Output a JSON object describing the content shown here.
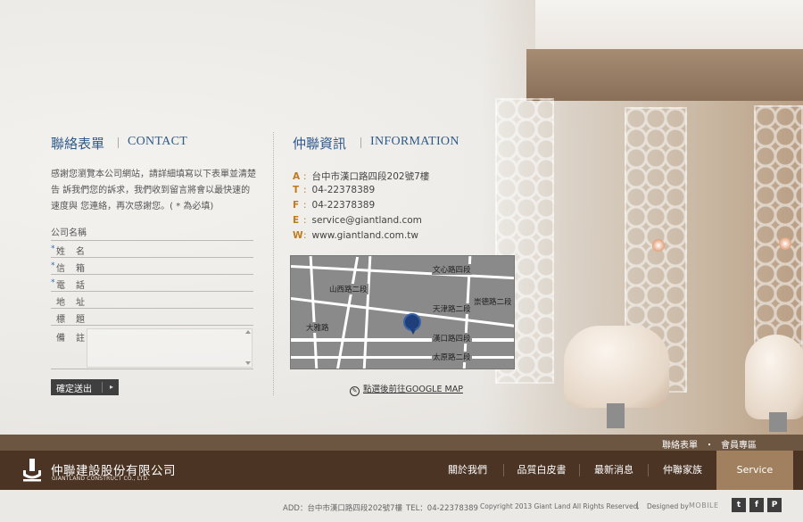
{
  "contact": {
    "title_cn": "聯絡表單",
    "title_en": "CONTACT",
    "intro": "感謝您瀏覽本公司網站，請詳細填寫以下表單並清楚告 訴我們您的訴求，我們收到留言將會以最快速的速度與 您連絡，再次感謝您。( * 為必填)",
    "company_label": "公司名稱",
    "fields": [
      {
        "label": "姓名",
        "required": "*"
      },
      {
        "label": "信箱",
        "required": "*"
      },
      {
        "label": "電話",
        "required": "*"
      },
      {
        "label": "地址",
        "required": ""
      },
      {
        "label": "標題",
        "required": ""
      }
    ],
    "notes_label": "備註",
    "submit_label": "確定送出"
  },
  "info": {
    "title_cn": "仲聯資訊",
    "title_en": "INFORMATION",
    "rows": [
      {
        "key": "A",
        "value": "台中市漢口路四段202號7樓"
      },
      {
        "key": "T",
        "value": "04-22378389"
      },
      {
        "key": "F",
        "value": "04-22378389"
      },
      {
        "key": "E",
        "value": "service@giantland.com"
      },
      {
        "key": "W",
        "value": "www.giantland.com.tw"
      }
    ],
    "map_labels": {
      "wenxin": "文心路四段",
      "shanxi": "山西路二段",
      "tianjin": "天津路二段",
      "chongde": "崇德路二段",
      "dagang": "大雅路",
      "hankou": "漢口路四段",
      "taiyuan": "太原路二段"
    },
    "gmap_link": "點選後前往GOOGLE MAP"
  },
  "topbar": {
    "link1": "聯絡表單",
    "sep": "・",
    "link2": "會員專區"
  },
  "brand": {
    "name_cn": "仲聯建設股份有限公司",
    "name_en": "GIANTLAND CONSTRUCT CO., LTD."
  },
  "nav": {
    "items": [
      "關於我們",
      "品質白皮書",
      "最新消息",
      "仲聯家族",
      "Service"
    ]
  },
  "footer": {
    "address": "ADD：台中市漢口路四段202號7樓",
    "tel": "TEL：04-22378389",
    "copyright": "Copyright 2013 Giant Land All Rights Reserved.",
    "divider": "|",
    "designed": "Designed by",
    "designer": "MOBILE",
    "social": [
      "t",
      "f",
      "P"
    ]
  },
  "colors": {
    "accent_blue": "#2f5a8a",
    "info_key": "#c17a1d",
    "nav_bg": "#4b3424",
    "topbar_bg": "#6c5541",
    "nav_active": "#a0805f"
  }
}
